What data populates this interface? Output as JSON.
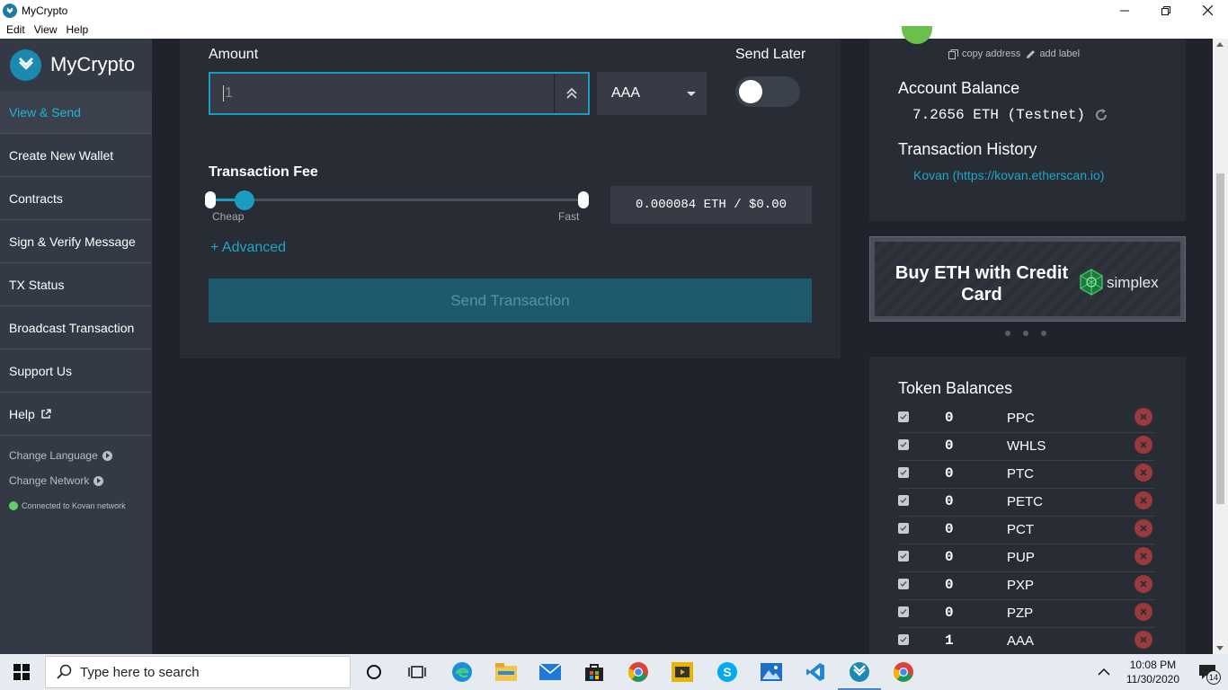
{
  "window": {
    "title": "MyCrypto",
    "controls": [
      "minimize",
      "maximize",
      "close"
    ]
  },
  "menu": [
    "Edit",
    "View",
    "Help"
  ],
  "sidebar": {
    "brand": "MyCrypto",
    "items": [
      {
        "label": "View & Send",
        "active": true
      },
      {
        "label": "Create New Wallet"
      },
      {
        "label": "Contracts"
      },
      {
        "label": "Sign & Verify Message"
      },
      {
        "label": "TX Status"
      },
      {
        "label": "Broadcast Transaction"
      },
      {
        "label": "Support Us"
      },
      {
        "label": "Help"
      }
    ],
    "change_language": "Change Language",
    "change_network": "Change Network",
    "network_status": "Connected to Kovan network"
  },
  "send": {
    "amount_label": "Amount",
    "amount_value": "1",
    "unit": "AAA",
    "send_later_label": "Send Later",
    "send_later_on": false,
    "fee_label": "Transaction Fee",
    "fee_level": 0.1,
    "slider_min_label": "Cheap",
    "slider_max_label": "Fast",
    "fee_value": "0.000084 ETH / $0.00",
    "advanced_label": "+ Advanced",
    "send_button": "Send Transaction"
  },
  "account": {
    "copy_address": "copy address",
    "add_label": "add label",
    "balance_title": "Account Balance",
    "balance": "7.2656 ETH (Testnet)",
    "history_title": "Transaction History",
    "history_link": "Kovan (https://kovan.etherscan.io)"
  },
  "ad": {
    "text": "Buy ETH with Credit Card",
    "brand": "simplex"
  },
  "tokens": {
    "title": "Token Balances",
    "rows": [
      {
        "balance": "0",
        "symbol": "PPC"
      },
      {
        "balance": "0",
        "symbol": "WHLS"
      },
      {
        "balance": "0",
        "symbol": "PTC"
      },
      {
        "balance": "0",
        "symbol": "PETC"
      },
      {
        "balance": "0",
        "symbol": "PCT"
      },
      {
        "balance": "0",
        "symbol": "PUP"
      },
      {
        "balance": "0",
        "symbol": "PXP"
      },
      {
        "balance": "0",
        "symbol": "PZP"
      },
      {
        "balance": "1",
        "symbol": "AAA"
      }
    ]
  },
  "taskbar": {
    "search_placeholder": "Type here to search",
    "time": "10:08 PM",
    "date": "11/30/2020",
    "notifications": "14"
  },
  "colors": {
    "accent": "#1b9dc2",
    "sidebar": "#333a45",
    "panel": "#282c35",
    "background": "#20232b"
  }
}
